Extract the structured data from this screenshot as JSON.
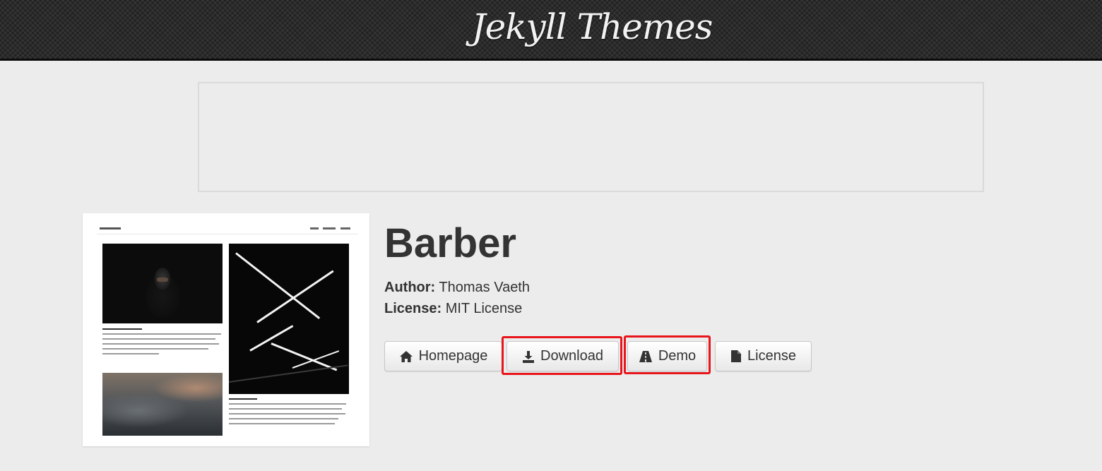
{
  "header": {
    "brand": "Jekyll Themes"
  },
  "theme": {
    "name": "Barber",
    "author_label": "Author:",
    "author": "Thomas Vaeth",
    "license_label": "License:",
    "license": "MIT License"
  },
  "actions": {
    "homepage": "Homepage",
    "download": "Download",
    "demo": "Demo",
    "license": "License"
  },
  "icons": {
    "homepage": "home-icon",
    "download": "download-icon",
    "demo": "road-icon",
    "license": "file-icon"
  },
  "colors": {
    "header_bg": "#2b2b2b",
    "page_bg": "#ececec",
    "highlight": "#e8151c",
    "text": "#333333"
  }
}
